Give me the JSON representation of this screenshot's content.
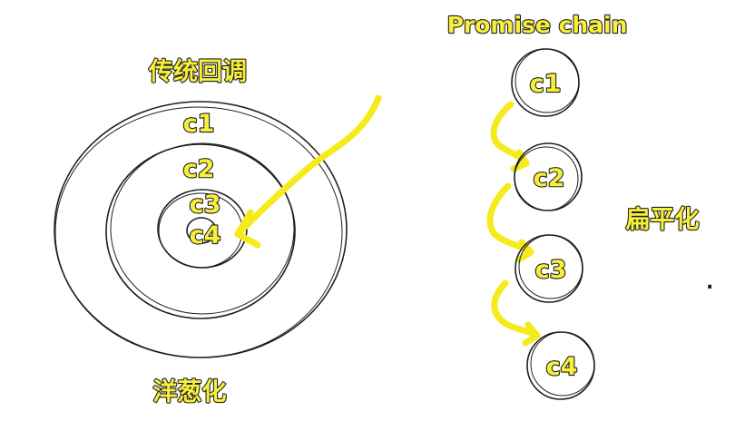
{
  "colors": {
    "highlight": "#f7ef3a",
    "outline": "#1f1f1f",
    "arrow": "#f5ea1a"
  },
  "left_panel": {
    "title": "传统回调",
    "caption": "洋葱化",
    "rings": [
      "c1",
      "c2",
      "c3",
      "c4"
    ]
  },
  "right_panel": {
    "title": "Promise chain",
    "caption": "扁平化",
    "nodes": [
      "c1",
      "c2",
      "c3",
      "c4"
    ]
  },
  "stray_mark": "."
}
